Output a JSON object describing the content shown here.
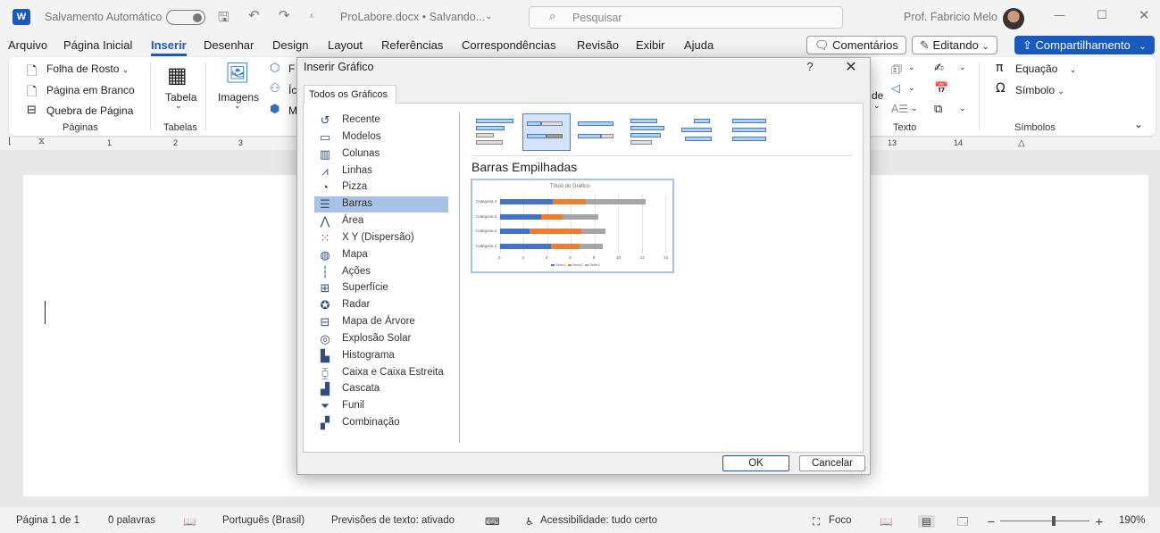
{
  "titlebar": {
    "autosave_label": "Salvamento Automático",
    "filename": "ProLabore.docx • Salvando...",
    "search_placeholder": "Pesquisar",
    "user": "Prof. Fabricio Melo"
  },
  "menu": {
    "items": [
      "Arquivo",
      "Página Inicial",
      "Inserir",
      "Desenhar",
      "Design",
      "Layout",
      "Referências",
      "Correspondências",
      "Revisão",
      "Exibir",
      "Ajuda"
    ],
    "active": "Inserir",
    "comments_label": "Comentários",
    "editing_label": "Editando",
    "share_label": "Compartilhamento"
  },
  "ribbon": {
    "cover_page": "Folha de Rosto",
    "blank_page": "Página em Branco",
    "page_break": "Quebra de Página",
    "group_pages": "Páginas",
    "table": "Tabela",
    "group_tables": "Tabelas",
    "images": "Imagens",
    "partial_f": "F",
    "partial_i": "Íc",
    "partial_m": "M",
    "partial_de": "de",
    "group_text": "Texto",
    "equation": "Equação",
    "symbol": "Símbolo",
    "group_symbols": "Símbolos"
  },
  "ruler": {
    "marks": [
      "1",
      "2",
      "3",
      "13",
      "14"
    ]
  },
  "dialog": {
    "title": "Inserir Gráfico",
    "help": "?",
    "tab_label": "Todos os Gráficos",
    "chart_types": [
      "Recente",
      "Modelos",
      "Colunas",
      "Linhas",
      "Pizza",
      "Barras",
      "Área",
      "X Y (Dispersão)",
      "Mapa",
      "Ações",
      "Superfície",
      "Radar",
      "Mapa de Árvore",
      "Explosão Solar",
      "Histograma",
      "Caixa e Caixa Estreita",
      "Cascata",
      "Funil",
      "Combinação"
    ],
    "selected_type": "Barras",
    "subtype_name": "Barras Empilhadas",
    "ok_label": "OK",
    "cancel_label": "Cancelar"
  },
  "chart_data": {
    "type": "bar",
    "title": "Título do Gráfico",
    "categories": [
      "Categoria 1",
      "Categoria 2",
      "Categoria 3",
      "Categoria 4"
    ],
    "series": [
      {
        "name": "Série1",
        "values": [
          4.3,
          2.5,
          3.5,
          4.5
        ],
        "color": "#4472c4"
      },
      {
        "name": "Série2",
        "values": [
          2.4,
          4.4,
          1.8,
          2.8
        ],
        "color": "#ed7d31"
      },
      {
        "name": "Série3",
        "values": [
          2,
          2,
          3,
          5
        ],
        "color": "#a5a5a5"
      }
    ],
    "xticks": [
      "0",
      "2",
      "4",
      "6",
      "8",
      "10",
      "12",
      "14"
    ],
    "xlim": [
      0,
      14
    ],
    "stacked": true,
    "orientation": "horizontal",
    "legend": "bottom"
  },
  "status": {
    "page": "Página 1 de 1",
    "words": "0 palavras",
    "language": "Português (Brasil)",
    "predictions": "Previsões de texto: ativado",
    "accessibility": "Acessibilidade: tudo certo",
    "focus": "Foco",
    "zoom": "190%"
  }
}
